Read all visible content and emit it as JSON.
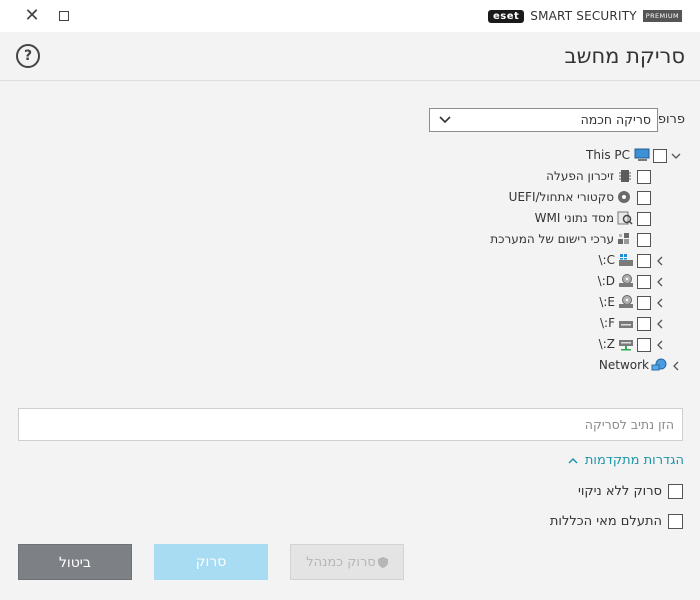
{
  "window": {
    "brand_logo": "eset",
    "brand_name": "SMART SECURITY",
    "brand_tier": "PREMIUM",
    "close_icon": "close-icon",
    "maximize_icon": "maximize-icon"
  },
  "header": {
    "title": "סריקת מחשב",
    "help_label": "?"
  },
  "profile": {
    "label": "פרופיל",
    "selected": "סריקה חכמה"
  },
  "tree": [
    {
      "label": "This PC",
      "icon": "computer-icon",
      "expanded": true,
      "checked": false
    },
    {
      "label": "זיכרון הפעלה",
      "icon": "memory-icon",
      "checked": false
    },
    {
      "label": "סקטורי אתחול/UEFI",
      "icon": "disc-icon",
      "checked": false
    },
    {
      "label": "מסד נתוני WMI",
      "icon": "wmi-icon",
      "checked": false
    },
    {
      "label": "ערכי רישום של המערכת",
      "icon": "registry-icon",
      "checked": false
    },
    {
      "label": "C:\\",
      "icon": "windows-drive-icon",
      "expanded": false,
      "checked": false
    },
    {
      "label": "D:\\",
      "icon": "optical-drive-icon",
      "expanded": false,
      "checked": false
    },
    {
      "label": "E:\\",
      "icon": "optical-drive-icon",
      "expanded": false,
      "checked": false
    },
    {
      "label": "F:\\",
      "icon": "drive-icon",
      "expanded": false,
      "checked": false
    },
    {
      "label": "Z:\\",
      "icon": "network-drive-icon",
      "expanded": false,
      "checked": false
    },
    {
      "label": "Network",
      "icon": "network-icon",
      "expanded": false
    }
  ],
  "path_input": {
    "placeholder": "הזן נתיב לסריקה",
    "value": ""
  },
  "advanced": {
    "label": "הגדרות מתקדמות",
    "expanded": true,
    "options": [
      {
        "label": "סרוק ללא ניקוי",
        "checked": false
      },
      {
        "label": "התעלם מאי הכללות",
        "checked": false
      }
    ]
  },
  "buttons": {
    "scan_as_admin": "סרוק כמנהל",
    "scan": "סרוק",
    "cancel": "ביטול"
  },
  "colors": {
    "accent": "#1e95a8",
    "scan_button": "#a8dcf2",
    "cancel_button": "#7d8186"
  }
}
